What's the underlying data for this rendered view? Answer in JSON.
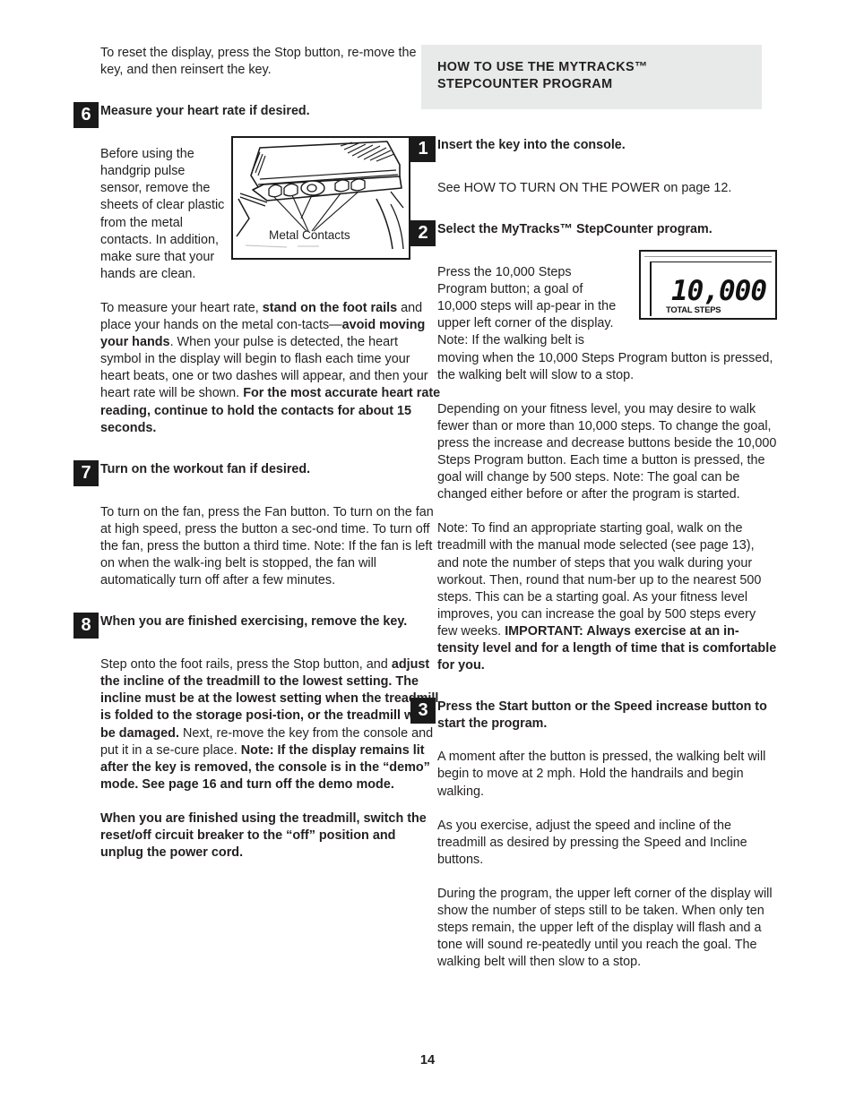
{
  "document": {
    "page_number": "14",
    "accent_badge_color": "#1a1a1a",
    "header_band_color": "#e8e9e9"
  },
  "left_column": {
    "intro_paragraph": "To reset the display, press the Stop button, re-move the key, and then reinsert the key.",
    "steps": [
      {
        "number": "6",
        "title": "Measure your heart rate if desired.",
        "paragraph_wrap": "Before using the handgrip pulse sensor, remove the sheets of clear plastic from the metal contacts. In addition, make sure that your hands are clean.",
        "paragraph_2_parts": [
          {
            "text": "To measure your heart rate, ",
            "bold": false
          },
          {
            "text": "stand on the foot rails",
            "bold": true
          },
          {
            "text": " and place your hands on the metal con-tacts—",
            "bold": false
          },
          {
            "text": "avoid moving your hands",
            "bold": true
          },
          {
            "text": ". When your pulse is detected, the heart symbol in the display will begin to flash each time your heart beats, one or two dashes will appear, and then your heart rate will be shown. ",
            "bold": false
          },
          {
            "text": "For the most accurate heart rate reading, continue to hold the contacts for about 15 seconds.",
            "bold": true
          }
        ]
      },
      {
        "number": "7",
        "title": "Turn on the workout fan if desired.",
        "paragraph_1": "To turn on the fan, press the Fan button. To turn on the fan at high speed, press the button a sec-ond time. To turn off the fan, press the button a third time. Note: If the fan is left on when the walk-ing belt is stopped, the fan will automatically turn off after a few minutes."
      },
      {
        "number": "8",
        "title": "When you are finished exercising, remove the key.",
        "paragraph_1_parts": [
          {
            "text": "Step onto the foot rails, press the Stop button, and ",
            "bold": false
          },
          {
            "text": "adjust the incline of the treadmill to the lowest setting. The incline must be at the lowest setting when the treadmill is folded to the storage posi-tion, or the treadmill will be damaged.",
            "bold": true
          },
          {
            "text": " Next, re-move the key from the console and put it in a se-cure place. ",
            "bold": false
          },
          {
            "text": "Note: If the display remains lit after the key is removed, the console is in the “demo” mode. See page 16 and turn off the demo mode.",
            "bold": true
          }
        ],
        "paragraph_2_bold": "When you are finished using the treadmill, switch the reset/off circuit breaker to the “off” position and unplug the power cord."
      }
    ],
    "figure_contacts": {
      "caption": "Metal Contacts",
      "alt": "line drawing of treadmill console handrail showing metal contacts"
    }
  },
  "right_column": {
    "section_header": {
      "line1": "HOW TO USE THE MYTRACKS™",
      "line2": "STEPCOUNTER PROGRAM"
    },
    "steps": [
      {
        "number": "1",
        "title": "Insert the key into the console.",
        "paragraph_1": "See HOW TO TURN ON THE POWER on page 12."
      },
      {
        "number": "2",
        "title": "Select the MyTracks™ StepCounter program.",
        "paragraph_wrap": "Press the 10,000 Steps Program button; a goal of 10,000 steps will ap-pear in the upper left corner of the display. Note: If the walking belt is moving when the 10,000 Steps Program button is pressed, the walking belt will slow to a stop.",
        "paragraph_2": "Depending on your fitness level, you may desire to walk fewer than or more than 10,000 steps. To change the goal, press the increase and decrease buttons beside the 10,000 Steps Program button. Each time a button is pressed, the goal will change by 500 steps. Note: The goal can be changed either before or after the program is started.",
        "paragraph_3_parts": [
          {
            "text": "Note: To find an appropriate starting goal, walk on the treadmill with the manual mode selected (see page 13), and note the number of steps that you walk during your workout. Then, round that num-ber up to the nearest 500 steps. This can be a starting goal. As your fitness level improves, you can increase the goal by 500 steps every few weeks. ",
            "bold": false
          },
          {
            "text": "IMPORTANT: Always exercise at an in-tensity level and for a length of time that is comfortable for you.",
            "bold": true
          }
        ]
      },
      {
        "number": "3",
        "title": "Press the Start button or the Speed increase button to start the program.",
        "paragraph_1": "A moment after the button is pressed, the walking belt will begin to move at 2 mph. Hold the handrails and begin walking.",
        "paragraph_2": "As you exercise, adjust the speed and incline of the treadmill as desired by pressing the Speed and Incline buttons.",
        "paragraph_3": "During the program, the upper left corner of the display will show the number of steps still to be taken. When only ten steps remain, the upper left of the display will flash and a tone will sound re-peatedly until you reach the goal. The walking belt will then slow to a stop."
      }
    ],
    "figure_lcd": {
      "digits": "10,000",
      "label": "TOTAL STEPS",
      "alt": "console display showing a goal of 10,000 total steps"
    }
  }
}
